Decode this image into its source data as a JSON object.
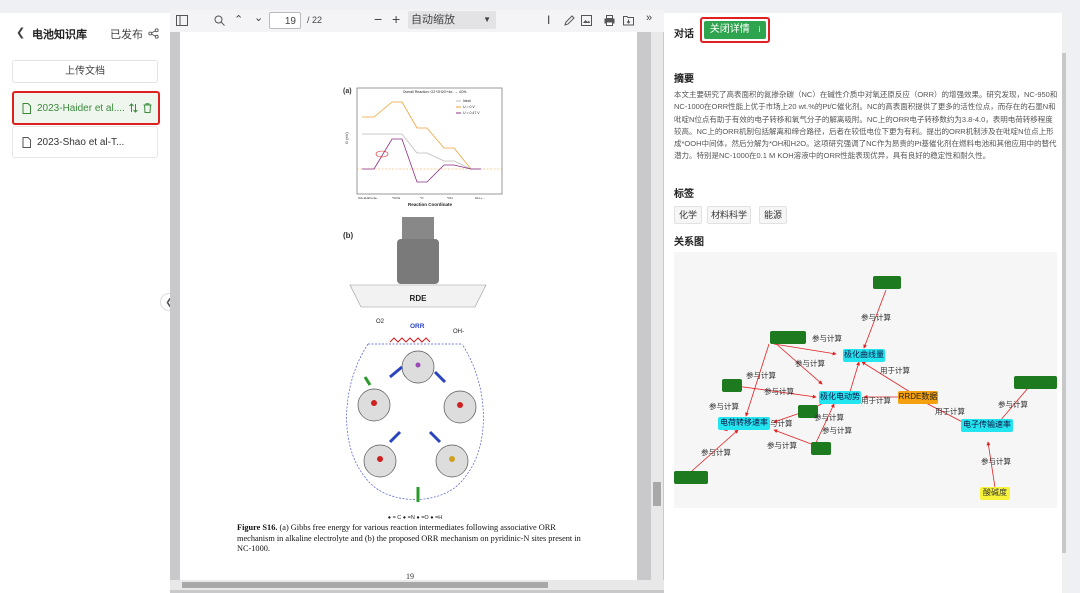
{
  "left_panel": {
    "back_label": "电池知识库",
    "publish_label": "已发布",
    "upload_label": "上传文档",
    "documents": [
      {
        "name": "2023-Haider et al...."
      },
      {
        "name": "2023-Shao et al-T..."
      }
    ]
  },
  "toolbar": {
    "page_current": "19",
    "page_total": "/ 22",
    "zoom_value": "自动缩放"
  },
  "pdf_page": {
    "panel_a_label": "(a)",
    "panel_b_label": "(b)",
    "chart_title": "Overall Reaction: O2+2H2O+4e- → 4OH-",
    "chart_ylabel": "G (eV)",
    "chart_xlabel": "Reaction Coordinate",
    "chart_legend": [
      "Ideal",
      "U = 0 V",
      "U = 0.47 V"
    ],
    "chart_xticks": [
      "O2+2H2O+4e-",
      "*OOH",
      "*O",
      "*OH",
      "OH-+..."
    ],
    "rde_label": "RDE",
    "orr_label": "ORR",
    "o2_label": "O2",
    "oh_label": "OH-",
    "atom_legend": "● = C  ● =N  ● =O  ● =H",
    "caption_label": "Figure S16.",
    "caption_text": " (a) Gibbs free energy for various reaction intermediates following associative ORR mechanism in alkaline electrolyte  and (b) the proposed ORR mechanism on pyridinic-N sites present in NC-1000.",
    "page_number": "19"
  },
  "right_panel": {
    "tab_label": "对话",
    "close_detail_label": "关闭详情",
    "abstract_title": "摘要",
    "abstract_text": "本文主要研究了高表面积的氮掺杂碳（NC）在碱性介质中对氧还原反应（ORR）的增强效果。研究发现，NC-950和NC-1000在ORR性能上优于市场上20 wt.%的Pt/C催化剂。NC的高表面积提供了更多的活性位点，而存在的石墨N和吡啶N位点有助于有效的电子转移和氧气分子的解离吸附。NC上的ORR电子转移数约为3.8-4.0，表明电荷转移程度较高。NC上的ORR机制包括解离和缔合路径，后者在较低电位下更为有利。提出的ORR机制涉及在吡啶N位点上形成*OOH中间体，然后分解为*OH和H2O。这项研究强调了NC作为昂贵的Pt基催化剂在燃料电池和其他应用中的替代潜力。特别是NC-1000在0.1 M KOH溶液中的ORR性能表现优异，具有良好的稳定性和耐久性。",
    "tags_title": "标签",
    "tags": [
      "化学",
      "材料科学",
      "能源"
    ],
    "graph_title": "关系图",
    "graph_nodes": [
      "极化曲线量",
      "极化电动势",
      "RRDE数据",
      "电荷转移速率",
      "电子传输速率",
      "酸碱度"
    ],
    "edge_labels": [
      "参与计算",
      "用于计算",
      "与计算"
    ]
  }
}
